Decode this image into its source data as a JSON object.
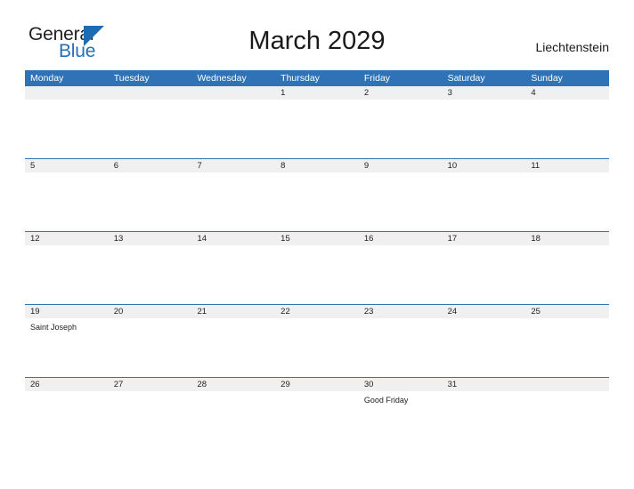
{
  "brand": {
    "name_part1": "General",
    "name_part2": "Blue",
    "accent_color": "#2470b8",
    "triangle_icon": "triangle-icon"
  },
  "header": {
    "title": "March 2029",
    "country": "Liechtenstein"
  },
  "calendar": {
    "header_color": "#2f72b5",
    "band_color": "#f0f0f0",
    "weekdays": [
      "Monday",
      "Tuesday",
      "Wednesday",
      "Thursday",
      "Friday",
      "Saturday",
      "Sunday"
    ],
    "weeks": [
      {
        "days": [
          {
            "num": "",
            "events": []
          },
          {
            "num": "",
            "events": []
          },
          {
            "num": "",
            "events": []
          },
          {
            "num": "1",
            "events": []
          },
          {
            "num": "2",
            "events": []
          },
          {
            "num": "3",
            "events": []
          },
          {
            "num": "4",
            "events": []
          }
        ]
      },
      {
        "days": [
          {
            "num": "5",
            "events": []
          },
          {
            "num": "6",
            "events": []
          },
          {
            "num": "7",
            "events": []
          },
          {
            "num": "8",
            "events": []
          },
          {
            "num": "9",
            "events": []
          },
          {
            "num": "10",
            "events": []
          },
          {
            "num": "11",
            "events": []
          }
        ]
      },
      {
        "days": [
          {
            "num": "12",
            "events": []
          },
          {
            "num": "13",
            "events": []
          },
          {
            "num": "14",
            "events": []
          },
          {
            "num": "15",
            "events": []
          },
          {
            "num": "16",
            "events": []
          },
          {
            "num": "17",
            "events": []
          },
          {
            "num": "18",
            "events": []
          }
        ]
      },
      {
        "days": [
          {
            "num": "19",
            "events": [
              "Saint Joseph"
            ]
          },
          {
            "num": "20",
            "events": []
          },
          {
            "num": "21",
            "events": []
          },
          {
            "num": "22",
            "events": []
          },
          {
            "num": "23",
            "events": []
          },
          {
            "num": "24",
            "events": []
          },
          {
            "num": "25",
            "events": []
          }
        ]
      },
      {
        "days": [
          {
            "num": "26",
            "events": []
          },
          {
            "num": "27",
            "events": []
          },
          {
            "num": "28",
            "events": []
          },
          {
            "num": "29",
            "events": []
          },
          {
            "num": "30",
            "events": [
              "Good Friday"
            ]
          },
          {
            "num": "31",
            "events": []
          },
          {
            "num": "",
            "events": []
          }
        ]
      }
    ]
  }
}
